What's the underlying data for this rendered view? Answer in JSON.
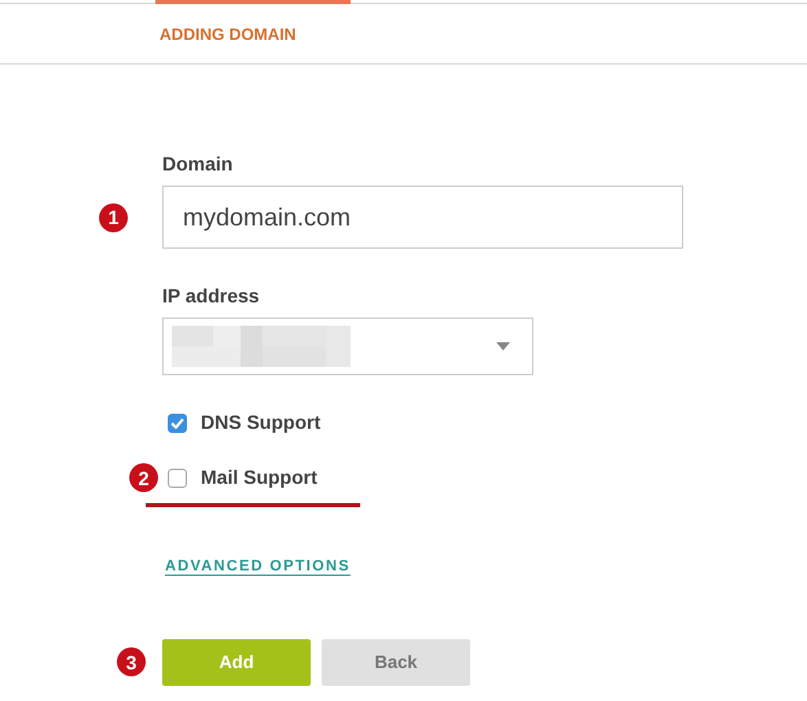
{
  "tabs": [
    {
      "label": "ADDING DOMAIN",
      "selected": true
    }
  ],
  "form": {
    "domain": {
      "label": "Domain",
      "value": "mydomain.com",
      "marker": "1"
    },
    "ip_address": {
      "label": "IP address",
      "redacted": true
    },
    "options": [
      {
        "label": "DNS Support",
        "checked": true
      },
      {
        "label": "Mail Support",
        "checked": false,
        "marker": "2",
        "underlined": true
      }
    ],
    "advanced_link": "ADVANCED OPTIONS",
    "buttons": [
      {
        "label": "Add",
        "kind": "primary",
        "marker": "3"
      },
      {
        "label": "Back",
        "kind": "secondary"
      }
    ]
  }
}
